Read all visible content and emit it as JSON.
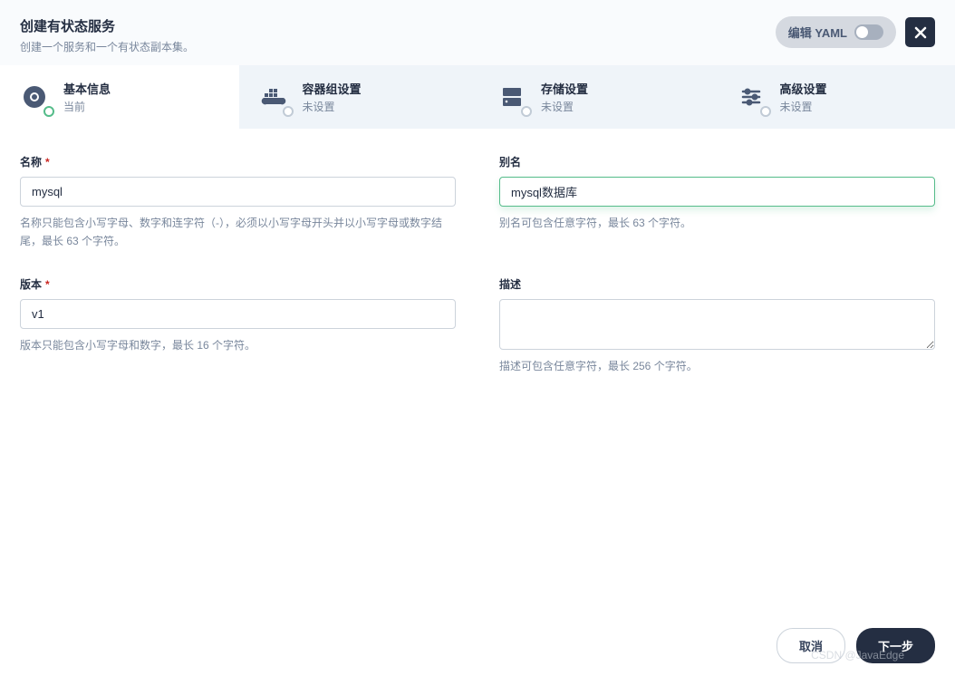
{
  "header": {
    "title": "创建有状态服务",
    "subtitle": "创建一个服务和一个有状态副本集。",
    "yaml_toggle_label": "编辑 YAML"
  },
  "steps": [
    {
      "title": "基本信息",
      "status": "当前",
      "icon": "basic-info-icon"
    },
    {
      "title": "容器组设置",
      "status": "未设置",
      "icon": "container-icon"
    },
    {
      "title": "存储设置",
      "status": "未设置",
      "icon": "storage-icon"
    },
    {
      "title": "高级设置",
      "status": "未设置",
      "icon": "advanced-icon"
    }
  ],
  "form": {
    "name": {
      "label": "名称",
      "value": "mysql",
      "hint": "名称只能包含小写字母、数字和连字符（-），必须以小写字母开头并以小写字母或数字结尾，最长 63 个字符。"
    },
    "alias": {
      "label": "别名",
      "value": "mysql数据库",
      "hint": "别名可包含任意字符，最长 63 个字符。"
    },
    "version": {
      "label": "版本",
      "value": "v1",
      "hint": "版本只能包含小写字母和数字，最长 16 个字符。"
    },
    "description": {
      "label": "描述",
      "value": "",
      "hint": "描述可包含任意字符，最长 256 个字符。"
    }
  },
  "footer": {
    "cancel": "取消",
    "next": "下一步"
  },
  "watermark": "CSDN @JavaEdge"
}
